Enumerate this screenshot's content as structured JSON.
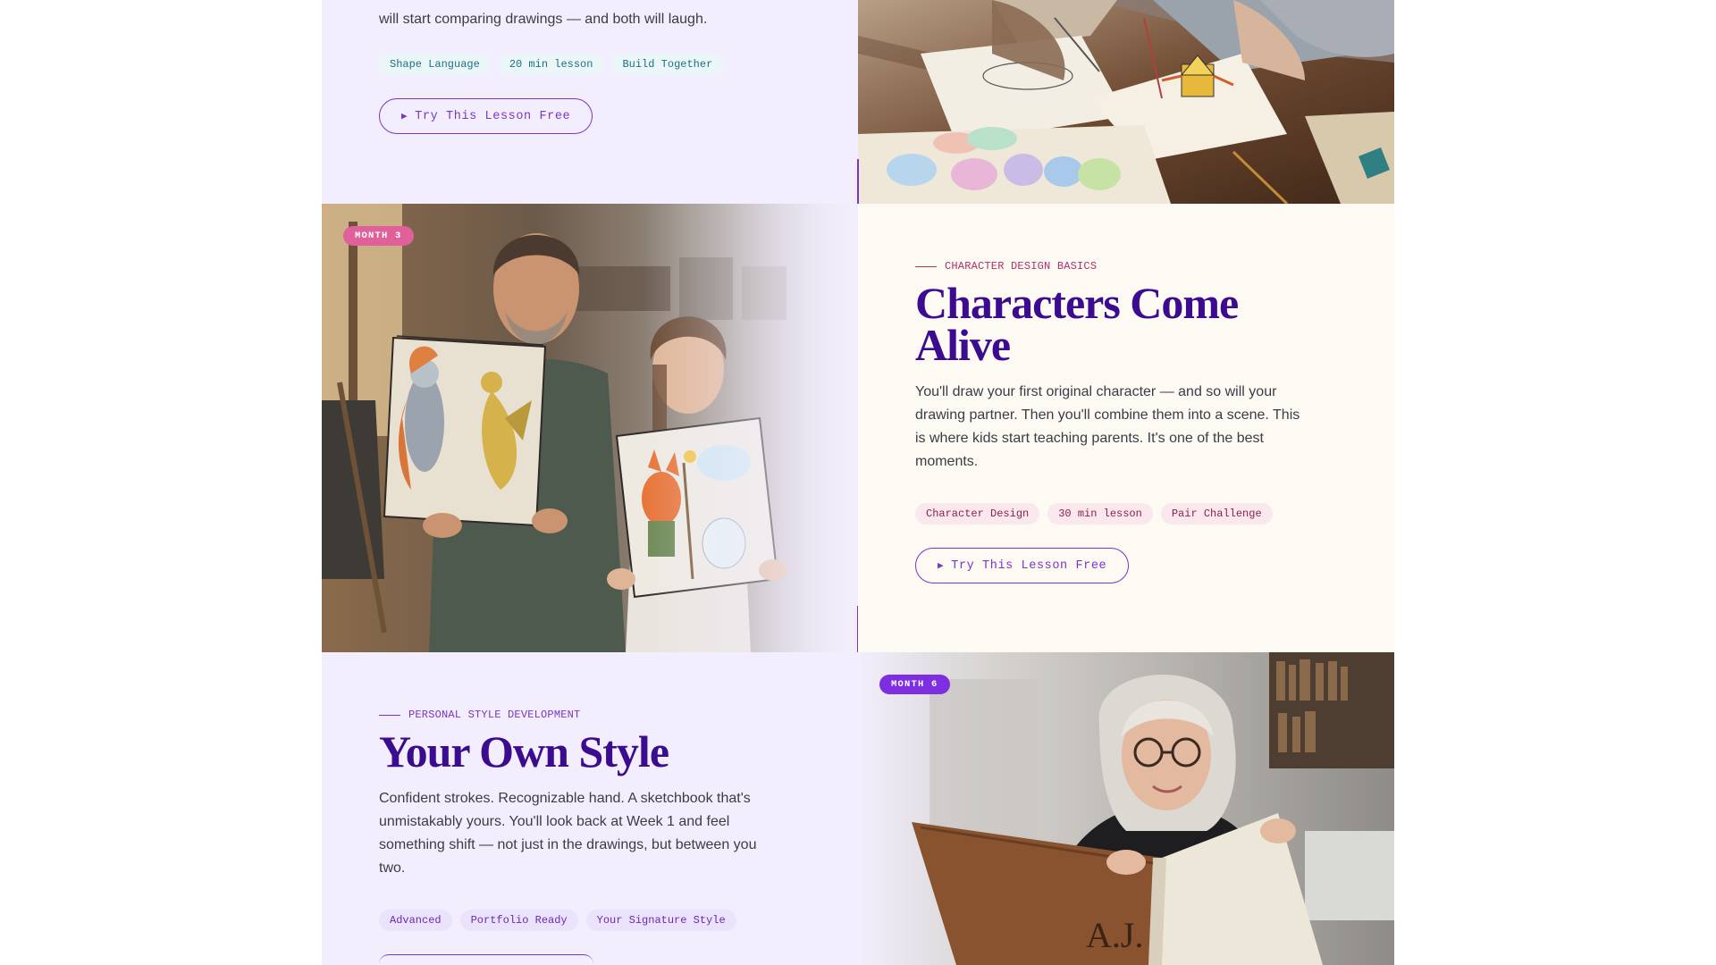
{
  "section1": {
    "body_tail": "will start comparing drawings — and both will laugh.",
    "tags": [
      "Shape Language",
      "20 min lesson",
      "Build Together"
    ],
    "cta": "Try This Lesson Free",
    "play_glyph": "▶"
  },
  "section2": {
    "badge": "MONTH 3",
    "eyebrow": "CHARACTER DESIGN BASICS",
    "title_line1": "Characters Come",
    "title_line2": "Alive",
    "body": "You'll draw your first original character — and so will your drawing partner. Then you'll combine them into a scene. This is where kids start teaching parents. It's one of the best moments.",
    "tags": [
      "Character Design",
      "30 min lesson",
      "Pair Challenge"
    ],
    "cta": "Try This Lesson Free",
    "play_glyph": "▶"
  },
  "section3": {
    "badge": "MONTH 6",
    "eyebrow": "PERSONAL STYLE DEVELOPMENT",
    "title": "Your Own Style",
    "body": "Confident strokes. Recognizable hand. A sketchbook that's unmistakably yours. You'll look back at Week 1 and feel something shift — not just in the drawings, but between you two.",
    "tags": [
      "Advanced",
      "Portfolio Ready",
      "Your Signature Style"
    ],
    "book_monogram": "A.J."
  },
  "colors": {
    "accent_purple": "#7a35c9",
    "title_purple": "#3b0c8f",
    "badge_pink": "#e0609a",
    "badge_purple": "#7c2ee0",
    "lavender_bg": "#f2eefd",
    "cream_bg": "#fdf9f3"
  }
}
